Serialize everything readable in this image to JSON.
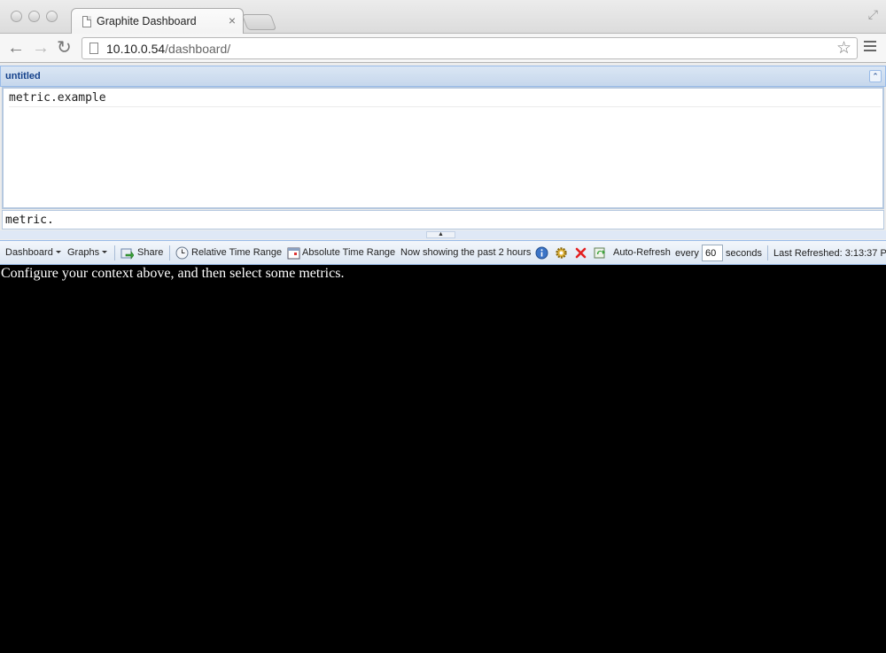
{
  "browser": {
    "tab_title": "Graphite Dashboard",
    "tab_close": "×",
    "url_host": "10.10.0.54",
    "url_path": "/dashboard/"
  },
  "panel": {
    "title": "untitled",
    "collapse_icon": "double-chevron-up-icon"
  },
  "context": {
    "lines": [
      "metric.example"
    ],
    "metric_input_value": "metric."
  },
  "toolbar": {
    "dashboard_menu": "Dashboard",
    "graphs_menu": "Graphs",
    "share_label": "Share",
    "relative_time_label": "Relative Time Range",
    "absolute_time_label": "Absolute Time Range",
    "time_status": "Now showing the past 2 hours",
    "auto_refresh_label": "Auto-Refresh",
    "every_label": "every",
    "refresh_interval": "60",
    "seconds_label": "seconds",
    "last_refreshed": "Last Refreshed: 3:13:37 P"
  },
  "graph_area": {
    "message": "Configure your context above, and then select some metrics."
  },
  "colors": {
    "panel_title": "#15428b",
    "graph_background": "#000000",
    "remove_icon": "#e32020",
    "info_icon": "#3b74c7"
  }
}
